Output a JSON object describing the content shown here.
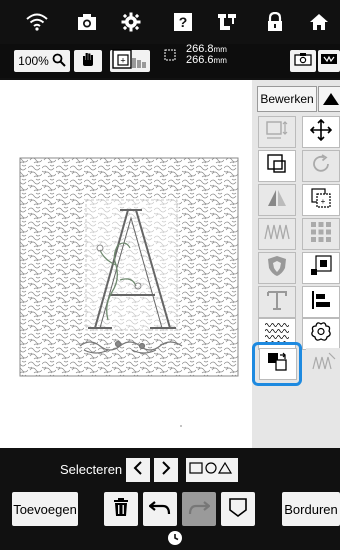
{
  "topbar": {
    "icons": [
      "wifi-icon",
      "camera-icon",
      "gear-icon",
      "help-icon",
      "machine-icon",
      "lock-icon",
      "home-icon"
    ]
  },
  "toolbar": {
    "zoom_label": "100%",
    "width_value": "266.8",
    "height_value": "266.6",
    "unit": "mm"
  },
  "panel": {
    "tab_label": "Bewerken"
  },
  "bottom": {
    "select_label": "Selecteren",
    "add_label": "Toevoegen",
    "embroider_label": "Borduren"
  }
}
